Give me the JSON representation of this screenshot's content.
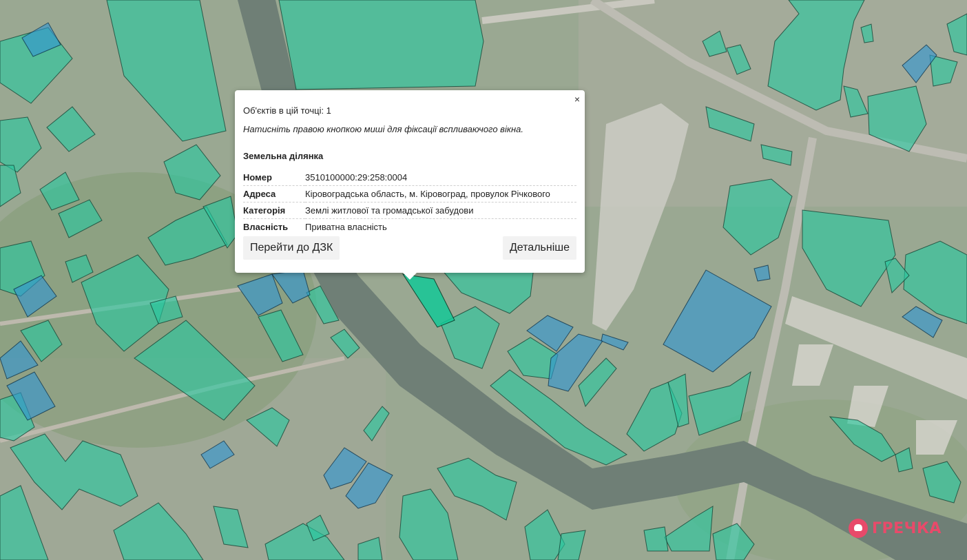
{
  "popup": {
    "close_symbol": "×",
    "objects_count": "Об'єктів в цій точці: 1",
    "hint": "Натисніть правою кнопкою миші для фіксації вспливаючого вікна.",
    "section_title": "Земельна ділянка",
    "rows": [
      {
        "key": "Номер",
        "value": "3510100000:29:258:0004"
      },
      {
        "key": "Адреса",
        "value": "Кіровоградська область, м. Кіровоград, провулок Річкового"
      },
      {
        "key": "Категорія",
        "value": "Землі житлової та громадської забудови"
      },
      {
        "key": "Власність",
        "value": "Приватна власність"
      }
    ],
    "button_dzk": "Перейти до ДЗК",
    "button_details": "Детальніше"
  },
  "logo": {
    "text": "ГРЕЧКА",
    "icon": "buckwheat-logo-icon",
    "color": "#e84a6a"
  },
  "map": {
    "parcel_color_green": "#28c8a0",
    "parcel_color_blue": "#3296d2",
    "river_color": "#6f7f76"
  }
}
